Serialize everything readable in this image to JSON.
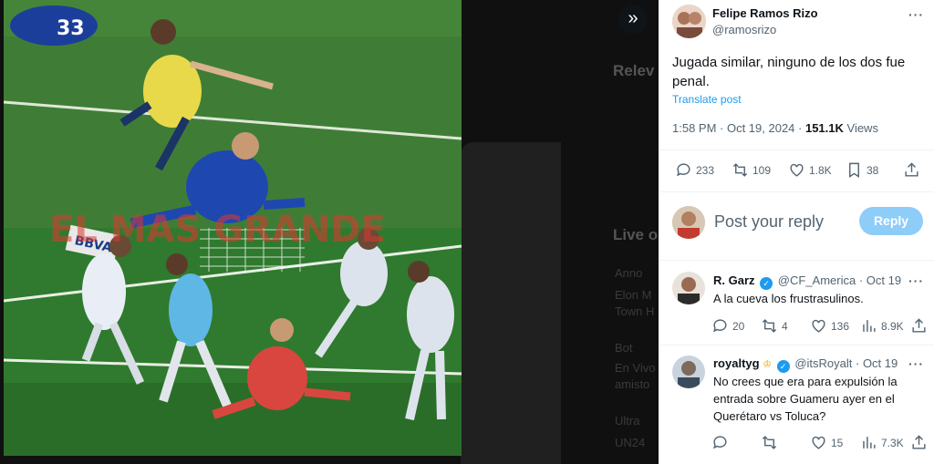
{
  "background": {
    "headings": [
      "Relev",
      "Live o"
    ],
    "snippets": [
      "Anno",
      "Elon M",
      "Town H",
      "Bot",
      "En Vivo",
      "amisto",
      "Ultra",
      "UN24"
    ]
  },
  "media": {
    "watermark": "EL MAS GRANDE",
    "shirt_number": "33",
    "ad_board": "BBVA"
  },
  "expand_icon": "»",
  "tweet": {
    "author_name": "Felipe Ramos Rizo",
    "author_handle": "@ramosrizo",
    "text": "Jugada similar, ninguno de los dos fue penal.",
    "translate": "Translate post",
    "time": "1:58 PM · Oct 19, 2024 · ",
    "views_count": "151.1K",
    "views_label": " Views",
    "replies": "233",
    "reposts": "109",
    "likes": "1.8K",
    "bookmarks": "38"
  },
  "composer": {
    "placeholder": "Post your reply",
    "reply_button": "Reply"
  },
  "replies": [
    {
      "name": "R. Garz",
      "handle": "@CF_America",
      "time": "· Oct 19",
      "text": "A la cueva los frustrasulinos.",
      "replies": "20",
      "reposts": "4",
      "likes": "136",
      "views": "8.9K"
    },
    {
      "name": "royaltyg",
      "handle": "@itsRoyalt",
      "time": "· Oct 19",
      "text": "No crees que era para expulsión la entrada sobre Guameru ayer en el Querétaro vs Toluca?",
      "replies": "",
      "reposts": "",
      "likes": "15",
      "views": "7.3K"
    }
  ],
  "colors": {
    "accent": "#1d9bf0",
    "reply_button": "#8ecdf8",
    "muted": "#536471"
  }
}
